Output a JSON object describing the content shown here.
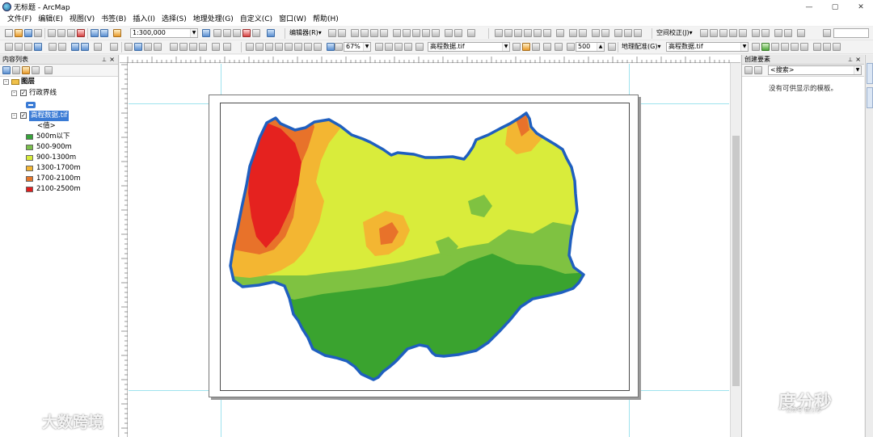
{
  "window": {
    "title": "无标题 - ArcMap",
    "controls": {
      "minimize": "—",
      "maximize": "▢",
      "close": "✕"
    }
  },
  "menubar": {
    "items": [
      "文件(F)",
      "编辑(E)",
      "视图(V)",
      "书签(B)",
      "插入(I)",
      "选择(S)",
      "地理处理(G)",
      "自定义(C)",
      "窗口(W)",
      "帮助(H)"
    ]
  },
  "toolbar": {
    "scale": "1:300,000",
    "editor_label": "编辑器(R)▾",
    "spatial_adjust_label": "空间校正(J)▾",
    "zoom_percent": "67%",
    "layer_combo": "高程数据.tif",
    "number_field": "500",
    "georef_label": "地理配准(G)▾",
    "georef_layer": "高程数据.tif"
  },
  "toc": {
    "title": "内容列表",
    "root_label": "图层",
    "expand_symbol": "-",
    "check_symbol": "✓",
    "layer_boundary": "行政界线",
    "layer_raster": "高程数据.tif",
    "value_label": "<值>",
    "legend": [
      {
        "label": "500m以下",
        "color": "#37a33a"
      },
      {
        "label": "500-900m",
        "color": "#7bc04b"
      },
      {
        "label": "900-1300m",
        "color": "#d7ec3a"
      },
      {
        "label": "1300-1700m",
        "color": "#f3b632"
      },
      {
        "label": "1700-2100m",
        "color": "#e6762a"
      },
      {
        "label": "2100-2500m",
        "color": "#e21d1d"
      }
    ]
  },
  "create_features": {
    "title": "创建要素",
    "search_placeholder": "<搜索>",
    "empty_message": "没有可供显示的模板。"
  },
  "map": {
    "boundary_color": "#1f5fbf",
    "colors": {
      "low": "#3aa32f",
      "mid_low": "#7fc241",
      "mid": "#d9ec3b",
      "mid_high": "#f3b632",
      "high": "#e8722a",
      "peak": "#e5221f"
    }
  },
  "watermarks": {
    "left": "大数跨境",
    "right": "度分秒",
    "right_sub": "公众号·度分秒"
  }
}
